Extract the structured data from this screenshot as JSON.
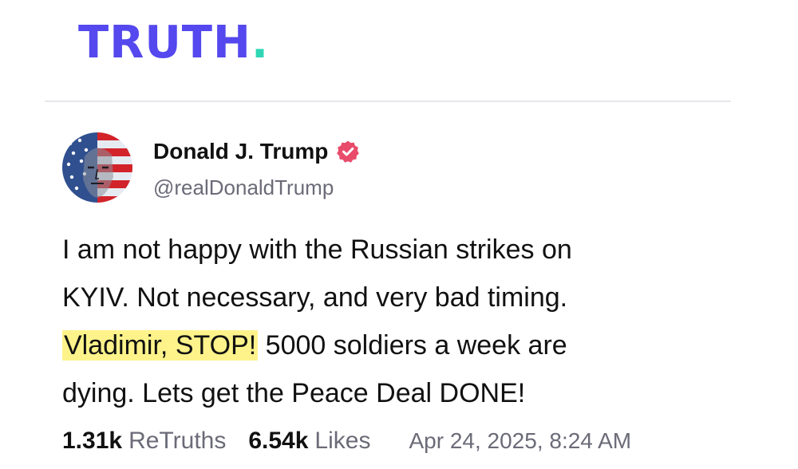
{
  "header": {
    "logo_word": "TRUTH",
    "logo_dot": ".",
    "brand_color": "#5448ee",
    "accent_color": "#2fd6b4"
  },
  "post": {
    "author": {
      "name": "Donald J. Trump",
      "handle": "@realDonaldTrump",
      "verified": true,
      "verified_color": "#e94b6b",
      "avatar_icon": "avatar-flag-portrait"
    },
    "body": {
      "line1": "I am not happy with the Russian strikes on",
      "line2": "KYIV. Not necessary, and very bad timing.",
      "highlighted": "Vladimir, STOP!",
      "line3_rest": " 5000 soldiers a week are",
      "line4": "dying. Lets get the Peace Deal DONE!",
      "highlight_color": "#fdf38a"
    },
    "stats": {
      "retruths_count": "1.31k",
      "retruths_label": "ReTruths",
      "likes_count": "6.54k",
      "likes_label": "Likes"
    },
    "timestamp": "Apr 24, 2025, 8:24 AM"
  }
}
